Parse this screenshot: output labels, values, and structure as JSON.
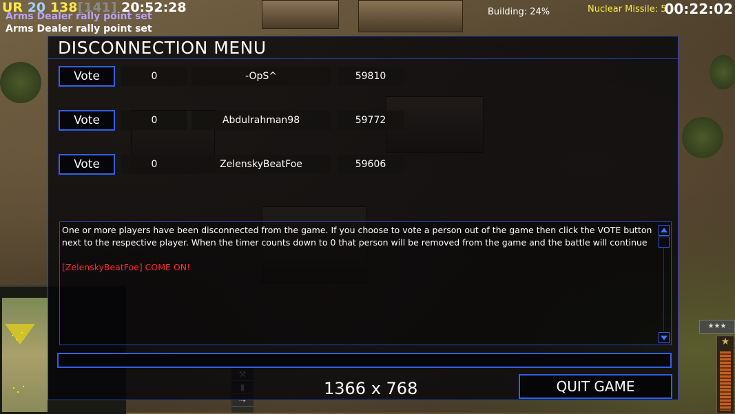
{
  "hud": {
    "ur_label": "UR",
    "stat_a": "20",
    "stat_b": "138",
    "stat_c": "[141]",
    "clock": "20:52:28",
    "rally_1": "Arms Dealer rally point set",
    "rally_2": "Arms Dealer rally point set",
    "building_status": "Building: 24%",
    "nuclear_label": "Nuclear Missile: 5",
    "countdown": "00:22:02"
  },
  "dialog": {
    "title": "DISCONNECTION MENU",
    "players": [
      {
        "vote_label": "Vote",
        "votes": "0",
        "name": "-OpS^",
        "ping": "59810"
      },
      {
        "vote_label": "Vote",
        "votes": "0",
        "name": "Abdulrahman98",
        "ping": "59772"
      },
      {
        "vote_label": "Vote",
        "votes": "0",
        "name": "ZelenskyBeatFoe",
        "ping": "59606"
      }
    ],
    "message": "One or more players have been disconnected from the game. If you choose to vote a person out of the game then click the VOTE button next to the respective player. When the timer counts down to 0 that person will be removed from the game and the battle will continue",
    "chat_line": "[ZelenskyBeatFoe] COME ON!",
    "chat_input_value": "",
    "resolution": "1366 x 768",
    "quit_label": "QUIT GAME"
  },
  "command_bar": {
    "rank_label": "★★★"
  },
  "colors": {
    "dialog_border": "#2b47b8",
    "button_border": "#2f62e8",
    "chat_red": "#ff2a2a",
    "hud_yellow": "#ffe94a"
  }
}
